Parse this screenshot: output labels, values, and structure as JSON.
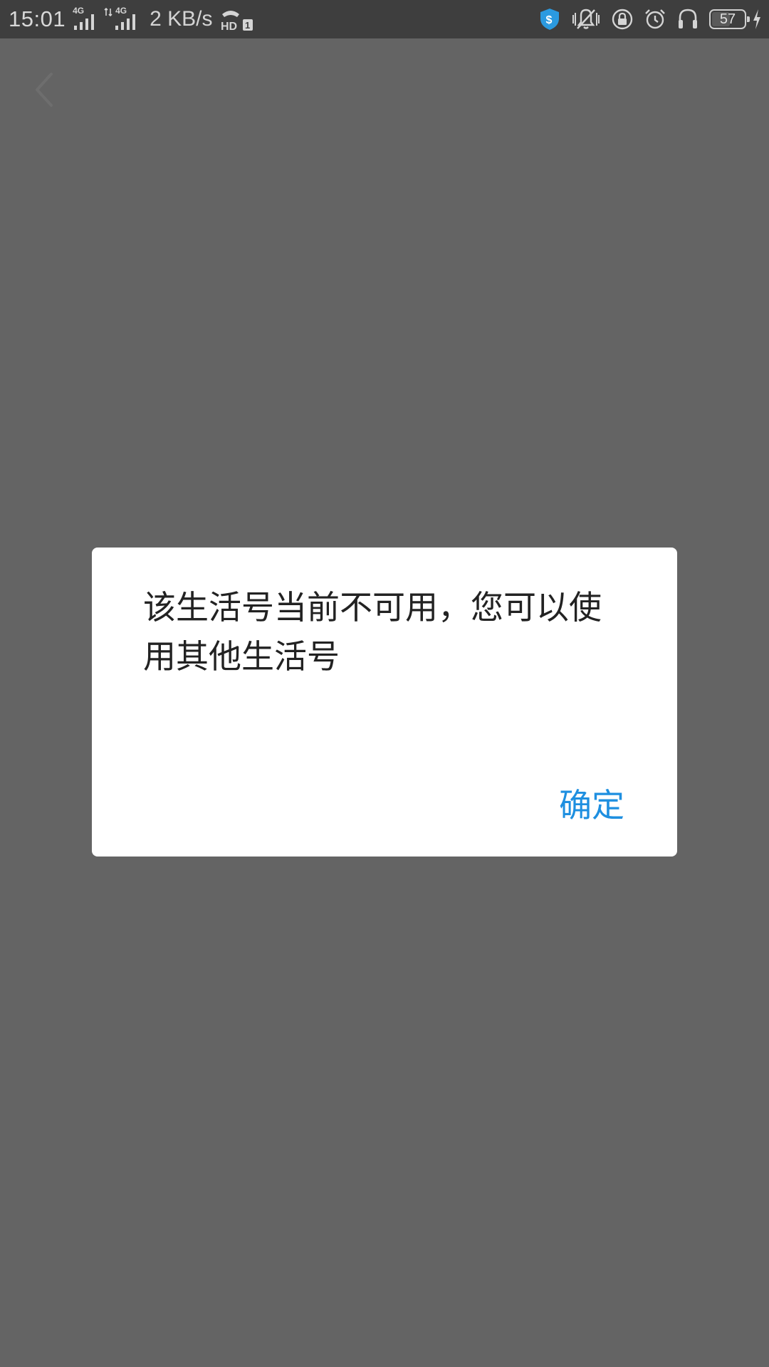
{
  "status_bar": {
    "time": "15:01",
    "network_1": "4G",
    "network_2": "4G",
    "speed": "2 KB/s",
    "battery_level": "57",
    "battery_fraction": 0.57,
    "icons": [
      "signal-icon",
      "hd-call-icon",
      "security-shield-icon",
      "vibrate-icon",
      "lock-rotation-icon",
      "alarm-icon",
      "headset-icon",
      "battery-icon",
      "charging-icon"
    ]
  },
  "navigation": {
    "back_icon": "chevron-left-icon"
  },
  "dialog": {
    "message": "该生活号当前不可用，您可以使用其他生活号",
    "confirm_label": "确定"
  },
  "colors": {
    "overlay": "#646464",
    "status_bar": "#3e3e3e",
    "accent": "#1e8fe0",
    "shield": "#2b9ae0"
  }
}
